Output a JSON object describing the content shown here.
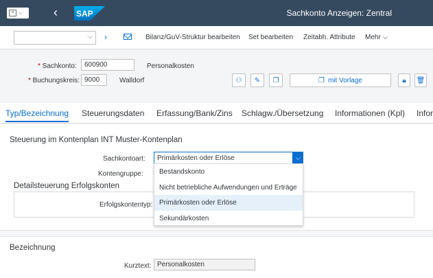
{
  "shell": {
    "menu_icon": "app-menu-icon",
    "back_icon": "back-icon",
    "logo": "SAP",
    "title": "Sachkonto Anzeigen: Zentral"
  },
  "toolbar": {
    "okcode_value": "",
    "links": [
      "Bilanz/GuV-Struktur bearbeiten",
      "Set bearbeiten",
      "Zeitabh. Attribute",
      "Mehr"
    ]
  },
  "header": {
    "sachkonto_label": "Sachkonto:",
    "sachkonto_value": "600900",
    "sachkonto_text": "Personalkosten",
    "bukrs_label": "Buchungskreis:",
    "bukrs_value": "9000",
    "bukrs_text": "Walldorf",
    "vorlage_label": "mit Vorlage"
  },
  "tabs": [
    "Typ/Bezeichnung",
    "Steuerungsdaten",
    "Erfassung/Bank/Zins",
    "Schlagw./Übersetzung",
    "Informationen (Kpl)",
    "Infor"
  ],
  "content": {
    "section1_title": "Steuerung im Kontenplan INT Muster-Kontenplan",
    "sachkontoart_label": "Sachkontoart:",
    "sachkontoart_value": "Primärkosten oder Erlöse",
    "kontengruppe_label": "Kontengruppe:",
    "detail_title": "Detailsteuerung Erfolgskonten",
    "erfolgskontentyp_label": "Erfolgskontentyp:",
    "dropdown_options": [
      "Bestandskonto",
      "Nicht betriebliche Aufwendungen und Erträge",
      "Primärkosten oder Erlöse",
      "Sekundärkosten"
    ],
    "section2_title": "Bezeichnung",
    "kurztext_label": "Kurztext:",
    "kurztext_value": "Personalkosten"
  },
  "colors": {
    "shell": "#354a5f",
    "accent": "#0a6ed1",
    "required": "#bb0000",
    "selected_option": "#e5f0fa"
  }
}
